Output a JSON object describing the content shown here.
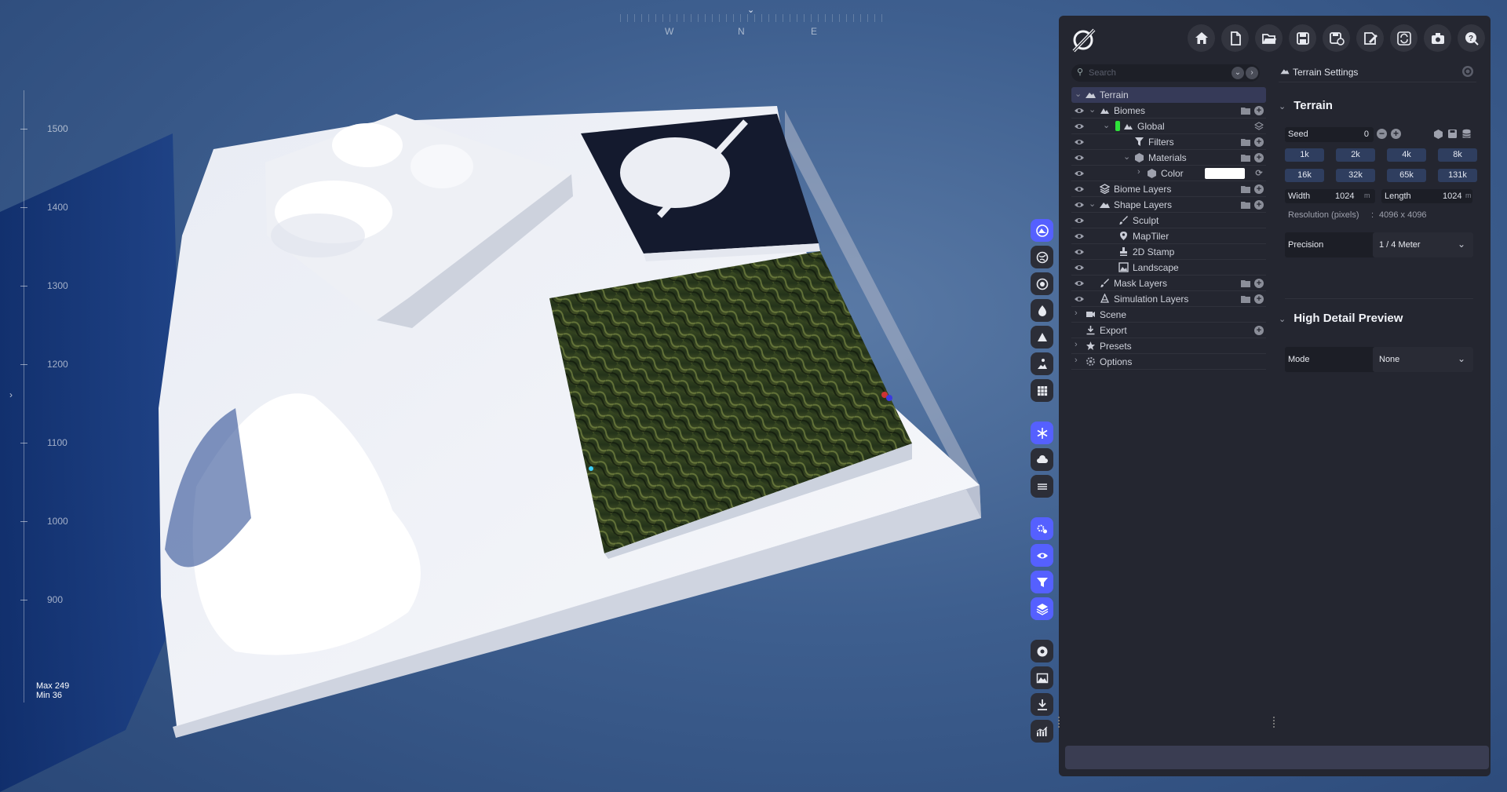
{
  "compass": {
    "labels": [
      "W",
      "N",
      "E"
    ]
  },
  "scale": {
    "ticks": [
      "1500",
      "1400",
      "1300",
      "1200",
      "1100",
      "1000",
      "900"
    ],
    "max_label": "Max 249",
    "min_label": "Min 36"
  },
  "toolstrip": {
    "tools": [
      {
        "name": "terrain-tool",
        "icon": "mountain-circle-icon",
        "active": true
      },
      {
        "name": "biome-tool",
        "icon": "globe-icon",
        "active": false
      },
      {
        "name": "shape-tool",
        "icon": "target-icon",
        "active": false
      },
      {
        "name": "water-tool",
        "icon": "drop-icon",
        "active": false
      },
      {
        "name": "peak-tool",
        "icon": "triangle-icon",
        "active": false
      },
      {
        "name": "sculpt-tool",
        "icon": "hiker-icon",
        "active": false
      },
      {
        "name": "grid-tool",
        "icon": "grid-icon",
        "active": false
      },
      {
        "name": "snow-tool",
        "icon": "snowflake-icon",
        "active": true
      },
      {
        "name": "cloud-tool",
        "icon": "cloud-icon",
        "active": false
      },
      {
        "name": "fog-tool",
        "icon": "layers-lines-icon",
        "active": false
      },
      {
        "name": "settings-tool",
        "icon": "gears-icon",
        "active": true
      },
      {
        "name": "view-tool",
        "icon": "eye-icon",
        "active": true
      },
      {
        "name": "filter-tool",
        "icon": "filter-icon",
        "active": true
      },
      {
        "name": "stack-tool",
        "icon": "stack-icon",
        "active": true
      },
      {
        "name": "record-tool",
        "icon": "record-icon",
        "active": false
      },
      {
        "name": "image-tool",
        "icon": "image-icon",
        "active": false
      },
      {
        "name": "download-tool",
        "icon": "download-icon",
        "active": false
      },
      {
        "name": "stats-tool",
        "icon": "stats-icon",
        "active": false
      }
    ]
  },
  "toolbar": {
    "buttons": [
      "home-icon",
      "new-file-icon",
      "open-folder-icon",
      "save-icon",
      "save-as-icon",
      "export-edit-icon",
      "refresh-icon",
      "camera-icon",
      "help-icon"
    ]
  },
  "search": {
    "placeholder": "Search"
  },
  "tree": {
    "terrain": "Terrain",
    "biomes": "Biomes",
    "global": "Global",
    "filters": "Filters",
    "materials": "Materials",
    "color": "Color",
    "biome_layers": "Biome Layers",
    "shape_layers": "Shape Layers",
    "sculpt": "Sculpt",
    "maptiler": "MapTiler",
    "stamp2d": "2D Stamp",
    "landscape": "Landscape",
    "mask_layers": "Mask Layers",
    "simulation_layers": "Simulation Layers",
    "scene": "Scene",
    "export": "Export",
    "presets": "Presets",
    "options": "Options"
  },
  "settings": {
    "header": "Terrain Settings",
    "terrain_section": "Terrain",
    "seed_label": "Seed",
    "seed_value": "0",
    "res_buttons": [
      "1k",
      "2k",
      "4k",
      "8k",
      "16k",
      "32k",
      "65k",
      "131k"
    ],
    "width_label": "Width",
    "width_value": "1024",
    "width_unit": "m",
    "length_label": "Length",
    "length_value": "1024",
    "length_unit": "m",
    "resolution_label": "Resolution (pixels)",
    "resolution_sep": ":",
    "resolution_value": "4096 x 4096",
    "precision_label": "Precision",
    "precision_value": "1 / 4 Meter",
    "hdp_section": "High Detail Preview",
    "mode_label": "Mode",
    "mode_value": "None"
  },
  "colors": {
    "accent": "#5560ff",
    "panel": "#242630",
    "selected_row": "#363a58",
    "global_tag": "#2ee23a"
  }
}
